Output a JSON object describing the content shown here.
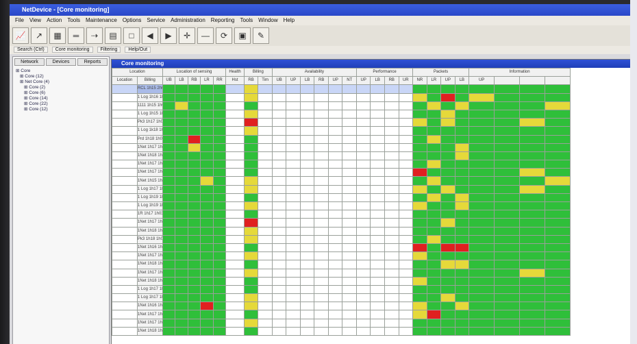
{
  "window": {
    "title": "NetDevice - [Core monitoring]"
  },
  "menu": [
    "File",
    "View",
    "Action",
    "Tools",
    "Maintenance",
    "Options",
    "Service",
    "Administration",
    "Reporting",
    "Tools",
    "Window",
    "Help"
  ],
  "toolbar": [
    "graph-icon",
    "arrow-icon",
    "chart-icon",
    "dash-icon",
    "arrow2-icon",
    "grid-icon",
    "blank-icon",
    "back-icon",
    "forward-icon",
    "plus-icon",
    "minus-icon",
    "refresh-icon",
    "save-icon",
    "tool-icon"
  ],
  "nav": {
    "tabs": [
      "Search (Ctrl)",
      "Core monitoring",
      "Filtering",
      "Help/Out"
    ]
  },
  "left_panel": {
    "tabs": [
      "Network",
      "Devices",
      "Reports"
    ],
    "tree": [
      "Core",
      "Core (12)",
      "Net Core (4)",
      "Core (2)",
      "Core (6)",
      "Core (14)",
      "Core (22)",
      "Core (12)"
    ]
  },
  "main": {
    "title": "Core monitoring",
    "header_groups": [
      "Location",
      "Location of sensing",
      "Health",
      "Billing",
      "Availability",
      "Performance",
      "Packets",
      "Information"
    ],
    "header_cols": [
      "Location",
      "Billing",
      "UB",
      "LB",
      "RB",
      "LR",
      "RR",
      "Hst",
      "RB",
      "Tim",
      "UB",
      "UP",
      "LB",
      "RB",
      "UP",
      "NT",
      "UP",
      "LB",
      "RB",
      "UR",
      "NR",
      "LR",
      "UP",
      "LB",
      "UP"
    ],
    "rows": [
      {
        "name": "RCL 1h15 2h02",
        "cells": [
          "w",
          "w",
          "g",
          "g",
          "g",
          "g",
          "g",
          "w",
          "y",
          "w",
          "w",
          "w",
          "w",
          "w",
          "w",
          "w",
          "w",
          "w",
          "w",
          "w",
          "g",
          "g",
          "g",
          "g",
          "g",
          "g",
          "g",
          "g"
        ]
      },
      {
        "name": "1 Log 1h16 1h03",
        "cells": [
          "w",
          "w",
          "g",
          "g",
          "g",
          "g",
          "g",
          "w",
          "y",
          "w",
          "w",
          "w",
          "w",
          "w",
          "w",
          "w",
          "w",
          "w",
          "w",
          "w",
          "y",
          "g",
          "r",
          "g",
          "y",
          "g",
          "g",
          "g"
        ]
      },
      {
        "name": "1111 1h15 1h02",
        "cells": [
          "w",
          "w",
          "g",
          "y",
          "g",
          "g",
          "g",
          "w",
          "g",
          "w",
          "w",
          "w",
          "w",
          "w",
          "w",
          "w",
          "w",
          "w",
          "w",
          "w",
          "g",
          "y",
          "g",
          "y",
          "g",
          "g",
          "g",
          "y"
        ]
      },
      {
        "name": "1 Log 1h15 1h10",
        "cells": [
          "w",
          "w",
          "g",
          "g",
          "g",
          "g",
          "g",
          "w",
          "y",
          "w",
          "w",
          "w",
          "w",
          "w",
          "w",
          "w",
          "w",
          "w",
          "w",
          "w",
          "g",
          "g",
          "y",
          "g",
          "g",
          "g",
          "g",
          "g"
        ]
      },
      {
        "name": "Pk3 1h17 1h04",
        "cells": [
          "w",
          "w",
          "g",
          "g",
          "g",
          "g",
          "g",
          "w",
          "r",
          "w",
          "w",
          "w",
          "w",
          "w",
          "w",
          "w",
          "w",
          "w",
          "w",
          "w",
          "y",
          "g",
          "y",
          "g",
          "g",
          "g",
          "y",
          "g"
        ]
      },
      {
        "name": "1 Log 1k18 1h02",
        "cells": [
          "w",
          "w",
          "g",
          "g",
          "g",
          "g",
          "g",
          "w",
          "y",
          "w",
          "w",
          "w",
          "w",
          "w",
          "w",
          "w",
          "w",
          "w",
          "w",
          "w",
          "g",
          "g",
          "g",
          "g",
          "g",
          "g",
          "g",
          "g"
        ]
      },
      {
        "name": "Prd 1h18 1h03",
        "cells": [
          "w",
          "w",
          "g",
          "g",
          "r",
          "g",
          "g",
          "w",
          "g",
          "w",
          "w",
          "w",
          "w",
          "w",
          "w",
          "w",
          "w",
          "w",
          "w",
          "w",
          "g",
          "y",
          "g",
          "g",
          "g",
          "g",
          "g",
          "g"
        ]
      },
      {
        "name": "1Net 1h17 1h03",
        "cells": [
          "w",
          "w",
          "g",
          "g",
          "y",
          "g",
          "g",
          "w",
          "g",
          "w",
          "w",
          "w",
          "w",
          "w",
          "w",
          "w",
          "w",
          "w",
          "w",
          "w",
          "g",
          "g",
          "g",
          "y",
          "g",
          "g",
          "g",
          "g"
        ]
      },
      {
        "name": "1Net 1h18 1h03",
        "cells": [
          "w",
          "w",
          "g",
          "g",
          "g",
          "g",
          "g",
          "w",
          "g",
          "w",
          "w",
          "w",
          "w",
          "w",
          "w",
          "w",
          "w",
          "w",
          "w",
          "w",
          "g",
          "g",
          "g",
          "y",
          "g",
          "g",
          "g",
          "g"
        ]
      },
      {
        "name": "1Net 1h17 1h03",
        "cells": [
          "w",
          "w",
          "g",
          "g",
          "g",
          "g",
          "g",
          "w",
          "g",
          "w",
          "w",
          "w",
          "w",
          "w",
          "w",
          "w",
          "w",
          "w",
          "w",
          "w",
          "g",
          "y",
          "g",
          "g",
          "g",
          "g",
          "g",
          "g"
        ]
      },
      {
        "name": "1Net 1h17 1h02",
        "cells": [
          "w",
          "w",
          "g",
          "g",
          "g",
          "g",
          "g",
          "w",
          "g",
          "w",
          "w",
          "w",
          "w",
          "w",
          "w",
          "w",
          "w",
          "w",
          "w",
          "w",
          "r",
          "g",
          "g",
          "g",
          "g",
          "g",
          "y",
          "g"
        ]
      },
      {
        "name": "1Net 1h15 1h04",
        "cells": [
          "w",
          "w",
          "g",
          "g",
          "g",
          "y",
          "g",
          "w",
          "y",
          "w",
          "w",
          "w",
          "w",
          "w",
          "w",
          "w",
          "w",
          "w",
          "w",
          "w",
          "g",
          "y",
          "g",
          "g",
          "g",
          "g",
          "g",
          "y"
        ]
      },
      {
        "name": "1 Log 1h17 1h03",
        "cells": [
          "w",
          "w",
          "g",
          "g",
          "g",
          "g",
          "g",
          "w",
          "y",
          "w",
          "w",
          "w",
          "w",
          "w",
          "w",
          "w",
          "w",
          "w",
          "w",
          "w",
          "y",
          "g",
          "y",
          "g",
          "g",
          "g",
          "y",
          "g"
        ]
      },
      {
        "name": "1 Log 1h19 1h02",
        "cells": [
          "w",
          "w",
          "g",
          "g",
          "g",
          "g",
          "g",
          "w",
          "g",
          "w",
          "w",
          "w",
          "w",
          "w",
          "w",
          "w",
          "w",
          "w",
          "w",
          "w",
          "g",
          "y",
          "g",
          "y",
          "g",
          "g",
          "g",
          "g"
        ]
      },
      {
        "name": "1 Log 1h19 1h03",
        "cells": [
          "w",
          "w",
          "g",
          "g",
          "g",
          "g",
          "g",
          "w",
          "y",
          "w",
          "w",
          "w",
          "w",
          "w",
          "w",
          "w",
          "w",
          "w",
          "w",
          "w",
          "y",
          "g",
          "g",
          "y",
          "g",
          "g",
          "g",
          "g"
        ]
      },
      {
        "name": "1R 1h17 1h03",
        "cells": [
          "w",
          "w",
          "g",
          "g",
          "g",
          "g",
          "g",
          "w",
          "g",
          "w",
          "w",
          "w",
          "w",
          "w",
          "w",
          "w",
          "w",
          "w",
          "w",
          "w",
          "g",
          "g",
          "g",
          "g",
          "g",
          "g",
          "g",
          "g"
        ]
      },
      {
        "name": "1Net 1h17 1h03",
        "cells": [
          "w",
          "w",
          "g",
          "g",
          "g",
          "g",
          "g",
          "w",
          "r",
          "w",
          "w",
          "w",
          "w",
          "w",
          "w",
          "w",
          "w",
          "w",
          "w",
          "w",
          "g",
          "g",
          "y",
          "g",
          "g",
          "g",
          "g",
          "g"
        ]
      },
      {
        "name": "1Net 1h18 1h02",
        "cells": [
          "w",
          "w",
          "g",
          "g",
          "g",
          "g",
          "g",
          "w",
          "y",
          "w",
          "w",
          "w",
          "w",
          "w",
          "w",
          "w",
          "w",
          "w",
          "w",
          "w",
          "g",
          "g",
          "g",
          "g",
          "g",
          "g",
          "g",
          "g"
        ]
      },
      {
        "name": "Pk3 1h18 1h03",
        "cells": [
          "w",
          "w",
          "g",
          "g",
          "g",
          "g",
          "g",
          "w",
          "y",
          "w",
          "w",
          "w",
          "w",
          "w",
          "w",
          "w",
          "w",
          "w",
          "w",
          "w",
          "g",
          "y",
          "g",
          "g",
          "g",
          "g",
          "g",
          "g"
        ]
      },
      {
        "name": "1Net 1h16 1h04",
        "cells": [
          "w",
          "w",
          "g",
          "g",
          "g",
          "g",
          "g",
          "w",
          "g",
          "w",
          "w",
          "w",
          "w",
          "w",
          "w",
          "w",
          "w",
          "w",
          "w",
          "w",
          "r",
          "g",
          "r",
          "r",
          "g",
          "g",
          "g",
          "g"
        ]
      },
      {
        "name": "1Net 1h17 1h03",
        "cells": [
          "w",
          "w",
          "g",
          "g",
          "g",
          "g",
          "g",
          "w",
          "y",
          "w",
          "w",
          "w",
          "w",
          "w",
          "w",
          "w",
          "w",
          "w",
          "w",
          "w",
          "y",
          "g",
          "g",
          "g",
          "g",
          "g",
          "g",
          "g"
        ]
      },
      {
        "name": "1Net 1h18 1h02",
        "cells": [
          "w",
          "w",
          "g",
          "g",
          "g",
          "g",
          "g",
          "w",
          "g",
          "w",
          "w",
          "w",
          "w",
          "w",
          "w",
          "w",
          "w",
          "w",
          "w",
          "w",
          "g",
          "g",
          "y",
          "y",
          "g",
          "g",
          "g",
          "g"
        ]
      },
      {
        "name": "1Net 1h17 1h03",
        "cells": [
          "w",
          "w",
          "g",
          "g",
          "g",
          "g",
          "g",
          "w",
          "y",
          "w",
          "w",
          "w",
          "w",
          "w",
          "w",
          "w",
          "w",
          "w",
          "w",
          "w",
          "g",
          "g",
          "g",
          "g",
          "g",
          "g",
          "y",
          "g"
        ]
      },
      {
        "name": "1Net 1h18 1h02",
        "cells": [
          "w",
          "w",
          "g",
          "g",
          "g",
          "g",
          "g",
          "w",
          "g",
          "w",
          "w",
          "w",
          "w",
          "w",
          "w",
          "w",
          "w",
          "w",
          "w",
          "w",
          "y",
          "g",
          "g",
          "g",
          "g",
          "g",
          "g",
          "g"
        ]
      },
      {
        "name": "1 Log 1h17 1h03",
        "cells": [
          "w",
          "w",
          "g",
          "g",
          "g",
          "g",
          "g",
          "w",
          "g",
          "w",
          "w",
          "w",
          "w",
          "w",
          "w",
          "w",
          "w",
          "w",
          "w",
          "w",
          "g",
          "g",
          "g",
          "g",
          "g",
          "g",
          "g",
          "g"
        ]
      },
      {
        "name": "1 Log 1h17 1h03",
        "cells": [
          "w",
          "w",
          "g",
          "g",
          "g",
          "g",
          "g",
          "w",
          "y",
          "w",
          "w",
          "w",
          "w",
          "w",
          "w",
          "w",
          "w",
          "w",
          "w",
          "w",
          "g",
          "g",
          "y",
          "g",
          "g",
          "g",
          "g",
          "g"
        ]
      },
      {
        "name": "1Net 1h16 1h03",
        "cells": [
          "w",
          "w",
          "g",
          "g",
          "g",
          "r",
          "g",
          "w",
          "y",
          "w",
          "w",
          "w",
          "w",
          "w",
          "w",
          "w",
          "w",
          "w",
          "w",
          "w",
          "y",
          "g",
          "g",
          "y",
          "g",
          "g",
          "g",
          "g"
        ]
      },
      {
        "name": "1Net 1h17 1h02",
        "cells": [
          "w",
          "w",
          "g",
          "g",
          "g",
          "g",
          "g",
          "w",
          "g",
          "w",
          "w",
          "w",
          "w",
          "w",
          "w",
          "w",
          "w",
          "w",
          "w",
          "w",
          "y",
          "r",
          "g",
          "g",
          "g",
          "g",
          "g",
          "g"
        ]
      },
      {
        "name": "1Net 1h17 1h03",
        "cells": [
          "w",
          "w",
          "g",
          "g",
          "g",
          "g",
          "g",
          "w",
          "y",
          "w",
          "w",
          "w",
          "w",
          "w",
          "w",
          "w",
          "w",
          "w",
          "w",
          "w",
          "g",
          "g",
          "g",
          "g",
          "g",
          "g",
          "g",
          "g"
        ]
      },
      {
        "name": "1Net 1h18 1h02",
        "cells": [
          "w",
          "w",
          "g",
          "g",
          "g",
          "g",
          "g",
          "w",
          "g",
          "w",
          "w",
          "w",
          "w",
          "w",
          "w",
          "w",
          "w",
          "w",
          "w",
          "w",
          "g",
          "g",
          "g",
          "g",
          "g",
          "g",
          "g",
          "g"
        ]
      }
    ]
  },
  "colors": {
    "ok": "#2fbf3a",
    "warn": "#e5d93a",
    "alarm": "#e02020",
    "title": "#2a48c8"
  }
}
